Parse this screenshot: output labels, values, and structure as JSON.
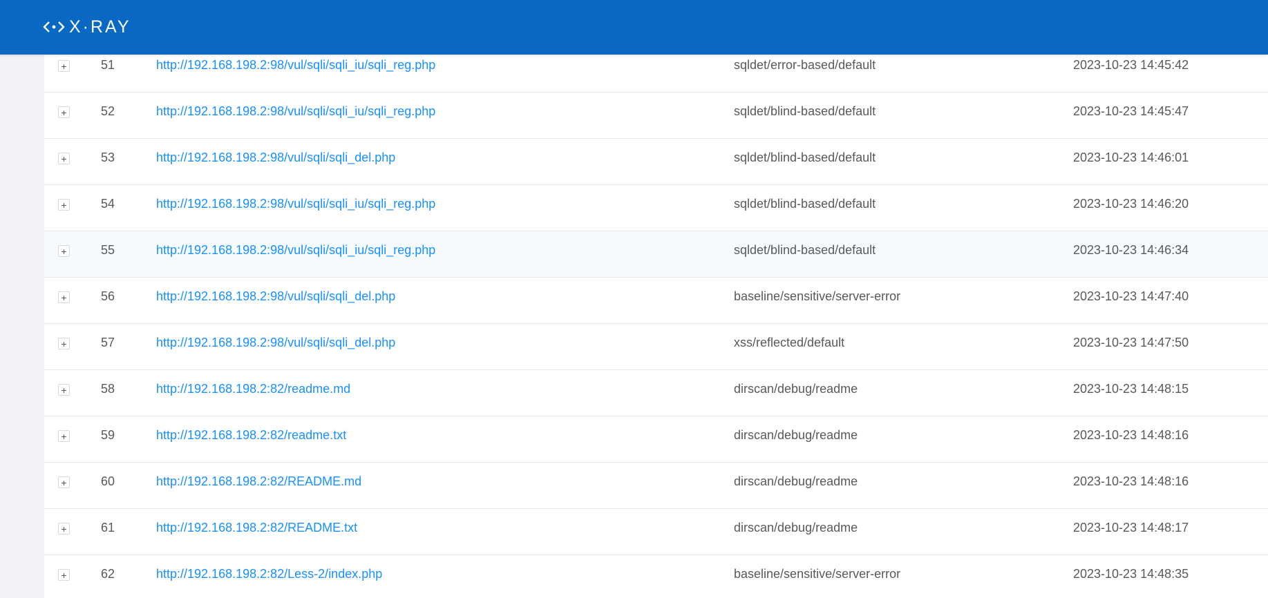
{
  "app": {
    "logo_text": "X·RAY"
  },
  "rows": [
    {
      "num": "51",
      "url": "http://192.168.198.2:98/vul/sqli/sqli_iu/sqli_reg.php",
      "plugin": "sqldet/error-based/default",
      "time": "2023-10-23 14:45:42"
    },
    {
      "num": "52",
      "url": "http://192.168.198.2:98/vul/sqli/sqli_iu/sqli_reg.php",
      "plugin": "sqldet/blind-based/default",
      "time": "2023-10-23 14:45:47"
    },
    {
      "num": "53",
      "url": "http://192.168.198.2:98/vul/sqli/sqli_del.php",
      "plugin": "sqldet/blind-based/default",
      "time": "2023-10-23 14:46:01"
    },
    {
      "num": "54",
      "url": "http://192.168.198.2:98/vul/sqli/sqli_iu/sqli_reg.php",
      "plugin": "sqldet/blind-based/default",
      "time": "2023-10-23 14:46:20"
    },
    {
      "num": "55",
      "url": "http://192.168.198.2:98/vul/sqli/sqli_iu/sqli_reg.php",
      "plugin": "sqldet/blind-based/default",
      "time": "2023-10-23 14:46:34"
    },
    {
      "num": "56",
      "url": "http://192.168.198.2:98/vul/sqli/sqli_del.php",
      "plugin": "baseline/sensitive/server-error",
      "time": "2023-10-23 14:47:40"
    },
    {
      "num": "57",
      "url": "http://192.168.198.2:98/vul/sqli/sqli_del.php",
      "plugin": "xss/reflected/default",
      "time": "2023-10-23 14:47:50"
    },
    {
      "num": "58",
      "url": "http://192.168.198.2:82/readme.md",
      "plugin": "dirscan/debug/readme",
      "time": "2023-10-23 14:48:15"
    },
    {
      "num": "59",
      "url": "http://192.168.198.2:82/readme.txt",
      "plugin": "dirscan/debug/readme",
      "time": "2023-10-23 14:48:16"
    },
    {
      "num": "60",
      "url": "http://192.168.198.2:82/README.md",
      "plugin": "dirscan/debug/readme",
      "time": "2023-10-23 14:48:16"
    },
    {
      "num": "61",
      "url": "http://192.168.198.2:82/README.txt",
      "plugin": "dirscan/debug/readme",
      "time": "2023-10-23 14:48:17"
    },
    {
      "num": "62",
      "url": "http://192.168.198.2:82/Less-2/index.php",
      "plugin": "baseline/sensitive/server-error",
      "time": "2023-10-23 14:48:35"
    }
  ],
  "expand_symbol": "+",
  "icons": {
    "logo": "xray-logo-icon",
    "expand": "plus-icon"
  },
  "colors": {
    "header": "#0969c2",
    "link": "#1890ff",
    "text": "#595959",
    "background": "#f0f2f5"
  }
}
